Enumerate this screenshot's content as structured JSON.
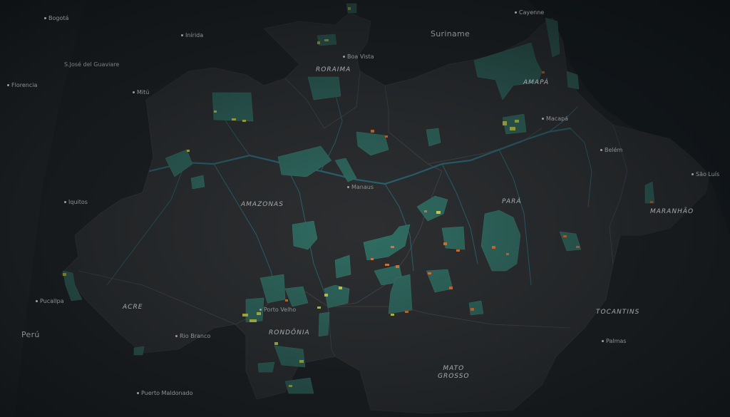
{
  "map": {
    "state_labels": {
      "roraima": "RORAIMA",
      "amapa": "AMAPÁ",
      "amazonas": "AMAZONAS",
      "para": "PARÁ",
      "maranhao": "MARANHÃO",
      "acre": "ACRE",
      "rondonia": "RONDÔNIA",
      "tocantins": "TOCANTINS",
      "mato_grosso": "MATO\nGROSSO"
    },
    "country_labels": {
      "suriname": "Suriname",
      "peru": "Perú"
    },
    "city_labels": {
      "bogota": "Bogotá",
      "cayenne": "Cayenne",
      "boa_vista": "Boa Vista",
      "macapa": "Macapá",
      "belem": "Belém",
      "sao_luis": "São Luís",
      "manaus": "Manaus",
      "porto_velho": "Porto Velho",
      "rio_branco": "Rio Branco",
      "palmas": "Palmas",
      "iquitos": "Iquitos",
      "pucallpa": "Pucallpa",
      "puerto_maldonado": "Puerto Maldonado",
      "florencia": "Florencia",
      "mitu": "Mitú",
      "inirida": "Inírida",
      "sjose_guaviare": "S.José del Guaviare"
    },
    "colors": {
      "background": "#15191c",
      "region_fill": "#2d2f31",
      "protected_area": "#2f6e63",
      "river": "#2a6a78",
      "ocean": "#0d1418",
      "alert_yellow": "#d7e24a",
      "alert_orange": "#e07a3e"
    }
  }
}
